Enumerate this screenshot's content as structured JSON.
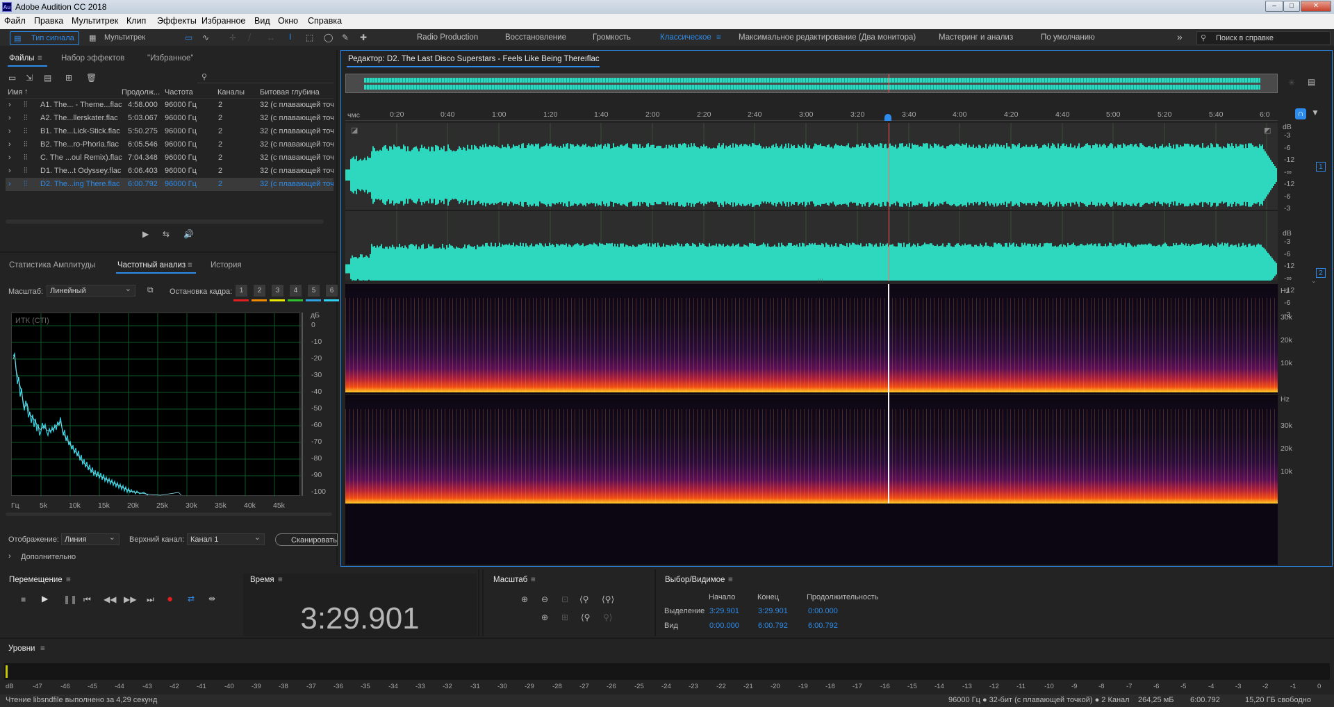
{
  "app": {
    "title": "Adobe Audition CC 2018",
    "icon": "Au"
  },
  "window_buttons": [
    "–",
    "□",
    "✕"
  ],
  "menu": [
    "Файл",
    "Правка",
    "Мультитрек",
    "Клип",
    "Эффекты",
    "Избранное",
    "Вид",
    "Окно",
    "Справка"
  ],
  "toolbar": {
    "view_waveform": "Тип сигнала",
    "view_multitrack": "Мультитрек",
    "workspaces": [
      "Radio Production",
      "Восстановление",
      "Громкость",
      "Классическое",
      "Максимальное редактирование (Два монитора)",
      "Мастеринг и анализ",
      "По умолчанию"
    ],
    "active_workspace": "Классическое",
    "more": "»",
    "search_placeholder": "Поиск в справке"
  },
  "files_panel": {
    "tabs": [
      "Файлы",
      "Набор эффектов",
      "\"Избранное\""
    ],
    "search_placeholder": "",
    "columns": [
      "Имя",
      "Продолж...",
      "Частота",
      "Каналы",
      "Битовая глубина"
    ],
    "sort_icon": "↑",
    "rows": [
      {
        "name": "A1. The... - Theme...flac",
        "dur": "4:58.000",
        "rate": "96000 Гц",
        "ch": "2",
        "depth": "32 (с плавающей точ"
      },
      {
        "name": "A2. The...llerskater.flac",
        "dur": "5:03.067",
        "rate": "96000 Гц",
        "ch": "2",
        "depth": "32 (с плавающей точ"
      },
      {
        "name": "B1. The...Lick-Stick.flac",
        "dur": "5:50.275",
        "rate": "96000 Гц",
        "ch": "2",
        "depth": "32 (с плавающей точ"
      },
      {
        "name": "B2. The...ro-Phoria.flac",
        "dur": "6:05.546",
        "rate": "96000 Гц",
        "ch": "2",
        "depth": "32 (с плавающей точ"
      },
      {
        "name": "C. The ...oul Remix).flac",
        "dur": "7:04.348",
        "rate": "96000 Гц",
        "ch": "2",
        "depth": "32 (с плавающей точ"
      },
      {
        "name": "D1. The...t Odyssey.flac",
        "dur": "6:06.403",
        "rate": "96000 Гц",
        "ch": "2",
        "depth": "32 (с плавающей точ"
      },
      {
        "name": "D2. The...ing There.flac",
        "dur": "6:00.792",
        "rate": "96000 Гц",
        "ch": "2",
        "depth": "32 (с плавающей точ"
      }
    ],
    "selected_index": 6
  },
  "analysis_panel": {
    "tabs": [
      "Статистика Амплитуды",
      "Частотный анализ",
      "История"
    ],
    "scale_label": "Масштаб:",
    "scale_value": "Линейный",
    "hold_label": "Остановка кадра:",
    "hold_buttons": [
      "1",
      "2",
      "3",
      "4",
      "5",
      "6"
    ],
    "hold_colors": [
      "#e02020",
      "#f08a00",
      "#e8e800",
      "#30c030",
      "#30a0e0",
      "#30d0f0"
    ],
    "graph_label": "ИТК (СТI)",
    "db_unit": "дБ",
    "db_ticks": [
      "0",
      "-10",
      "-20",
      "-30",
      "-40",
      "-50",
      "-60",
      "-70",
      "-80",
      "-90",
      "-100"
    ],
    "freq_ticks": [
      "Гц",
      "5k",
      "10k",
      "15k",
      "20k",
      "25k",
      "30k",
      "35k",
      "40k",
      "45k"
    ],
    "display_label": "Отображение:",
    "display_value": "Линия",
    "channel_label": "Верхний канал:",
    "channel_value": "Канал 1",
    "scan_button": "Сканировать",
    "advanced": "Дополнительно"
  },
  "editor": {
    "title": "Редактор: D2. The Last Disco Superstars - Feels Like Being There.flac",
    "ruler_unit": "чмс",
    "ruler_ticks": [
      "0:20",
      "0:40",
      "1:00",
      "1:20",
      "1:40",
      "2:00",
      "2:20",
      "2:40",
      "3:00",
      "3:20",
      "3:40",
      "4:00",
      "4:20",
      "4:40",
      "5:00",
      "5:20",
      "5:40",
      "6:0"
    ],
    "db_unit": "dB",
    "db_ticks": [
      "-3",
      "-6",
      "-12",
      "-∞",
      "-12",
      "-6",
      "-3"
    ],
    "channel_badges": [
      "1",
      "2"
    ],
    "hz_unit": "Hz",
    "hz_ticks": [
      "30k",
      "20k",
      "10k"
    ],
    "waveform_color": "#2ed8bf",
    "playhead_fraction": 0.5826
  },
  "transport": {
    "title": "Перемещение",
    "buttons": [
      "stop-icon",
      "play-icon",
      "pause-icon",
      "to-start-icon",
      "rewind-icon",
      "fast-forward-icon",
      "to-end-icon",
      "record-icon",
      "loop-icon",
      "skip-selection-icon"
    ]
  },
  "time_panel": {
    "title": "Время",
    "value": "3:29.901"
  },
  "zoom_panel": {
    "title": "Масштаб"
  },
  "selection_panel": {
    "title": "Выбор/Видимое",
    "headers": [
      "Начало",
      "Конец",
      "Продолжительность"
    ],
    "selection_label": "Выделение",
    "selection": [
      "3:29.901",
      "3:29.901",
      "0:00.000"
    ],
    "view_label": "Вид",
    "view": [
      "0:00.000",
      "6:00.792",
      "6:00.792"
    ]
  },
  "levels": {
    "title": "Уровни",
    "ticks": [
      "dB",
      "-47",
      "-46",
      "-45",
      "-44",
      "-43",
      "-42",
      "-41",
      "-40",
      "-39",
      "-38",
      "-37",
      "-36",
      "-35",
      "-34",
      "-33",
      "-32",
      "-31",
      "-30",
      "-29",
      "-28",
      "-27",
      "-26",
      "-25",
      "-24",
      "-23",
      "-22",
      "-21",
      "-20",
      "-19",
      "-18",
      "-17",
      "-16",
      "-15",
      "-14",
      "-13",
      "-12",
      "-11",
      "-10",
      "-9",
      "-8",
      "-7",
      "-6",
      "-5",
      "-4",
      "-3",
      "-2",
      "-1",
      "0"
    ]
  },
  "status": {
    "left": "Чтение libsndfile выполнено за 4,29 секунд",
    "format": "96000 Гц ● 32-бит (с плавающей точкой) ● 2 Канал",
    "size": "264,25 мБ",
    "duration": "6:00.792",
    "free": "15,20 ГБ свободно"
  }
}
